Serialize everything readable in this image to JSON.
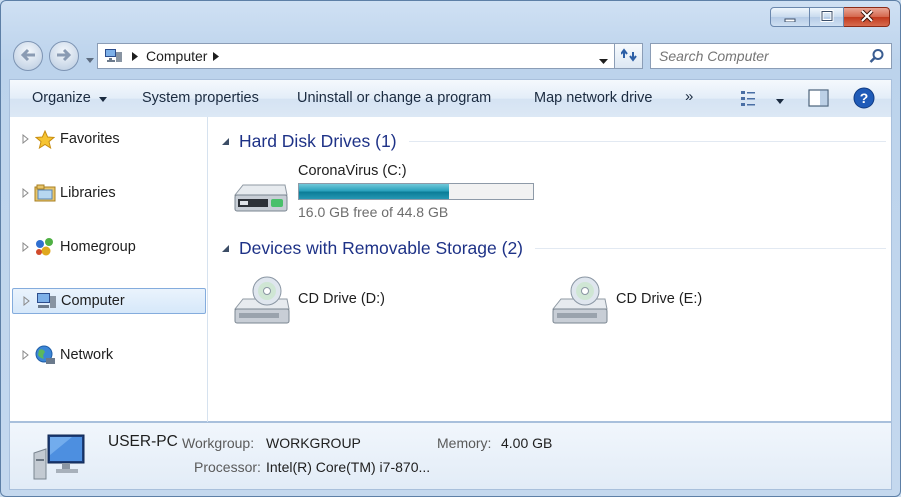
{
  "window": {
    "minimize_icon": "minimize-icon",
    "maximize_icon": "maximize-icon",
    "close_icon": "close-icon",
    "close_color": "#c1391d"
  },
  "address_bar": {
    "crumb": "Computer",
    "search_placeholder": "Search Computer"
  },
  "toolbar": {
    "organize": "Organize",
    "system_properties": "System properties",
    "uninstall": "Uninstall or change a program",
    "map_drive": "Map network drive",
    "overflow": "»"
  },
  "nav_pane": {
    "items": [
      {
        "label": "Favorites",
        "icon": "star-icon"
      },
      {
        "label": "Libraries",
        "icon": "libraries-icon"
      },
      {
        "label": "Homegroup",
        "icon": "homegroup-icon"
      },
      {
        "label": "Computer",
        "icon": "computer-icon",
        "selected": true
      },
      {
        "label": "Network",
        "icon": "network-icon"
      }
    ]
  },
  "groups": {
    "hard_disks": {
      "label": "Hard Disk Drives (1)",
      "drives": [
        {
          "name": "CoronaVirus (C:)",
          "free_text": "16.0 GB free of 44.8 GB",
          "used_fraction": 0.643
        }
      ]
    },
    "removable": {
      "label": "Devices with Removable Storage (2)",
      "drives": [
        {
          "name": "CD Drive (D:)"
        },
        {
          "name": "CD Drive (E:)"
        }
      ]
    }
  },
  "details": {
    "computer_name": "USER-PC",
    "workgroup_label": "Workgroup:",
    "workgroup_value": "WORKGROUP",
    "memory_label": "Memory:",
    "memory_value": "4.00 GB",
    "processor_label": "Processor:",
    "processor_value": "Intel(R) Core(TM) i7-870..."
  },
  "colors": {
    "group_heading": "#1e3287",
    "progress_fill": "#1a8ca8",
    "selection_border": "#84acdd"
  }
}
